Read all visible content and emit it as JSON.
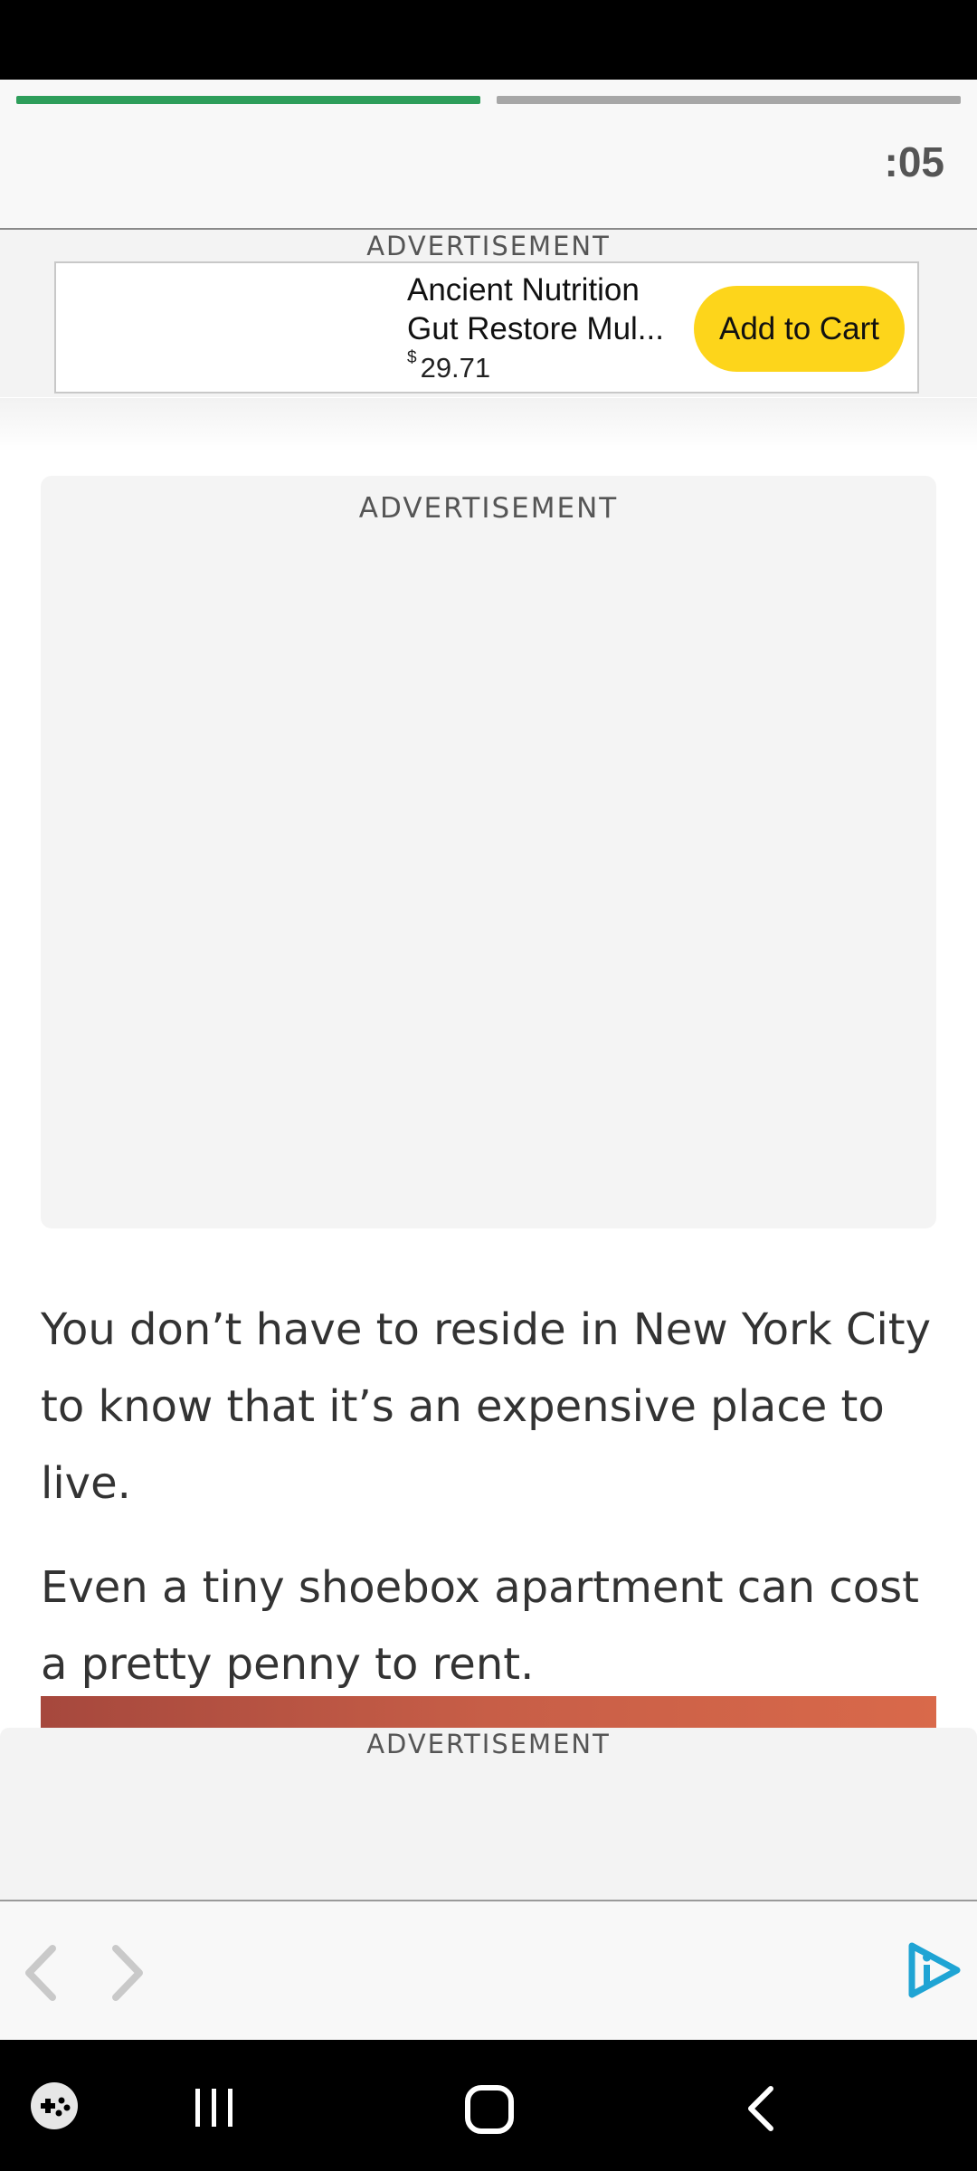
{
  "stories": {
    "progress": [
      1.0,
      0.0
    ],
    "timer": ":05"
  },
  "top_ad": {
    "label": "ADVERTISEMENT",
    "product_name_line1": "Ancient Nutrition",
    "product_name_line2": "Gut Restore Mul...",
    "price_currency": "$",
    "price_value": "29.71",
    "cta_label": "Add to Cart"
  },
  "mid_ad": {
    "label": "ADVERTISEMENT"
  },
  "article": {
    "paragraphs": [
      "You don’t have to reside in New York City to know that it’s an expensive place to live.",
      "Even a tiny shoebox apartment can cost a pretty penny to rent."
    ]
  },
  "bottom_ad": {
    "label": "ADVERTISEMENT"
  },
  "nav": {
    "icons": [
      "chevron-left-icon",
      "chevron-right-icon",
      "brand-logo-icon"
    ]
  },
  "system_nav": {
    "icons": [
      "game-launcher-icon",
      "recent-apps-icon",
      "home-icon",
      "back-icon"
    ]
  },
  "colors": {
    "progress_active": "#2e9e5b",
    "progress_inactive": "#a7a7a7",
    "cart_button": "#fdd51b",
    "brand_logo": "#1fa4d4"
  }
}
